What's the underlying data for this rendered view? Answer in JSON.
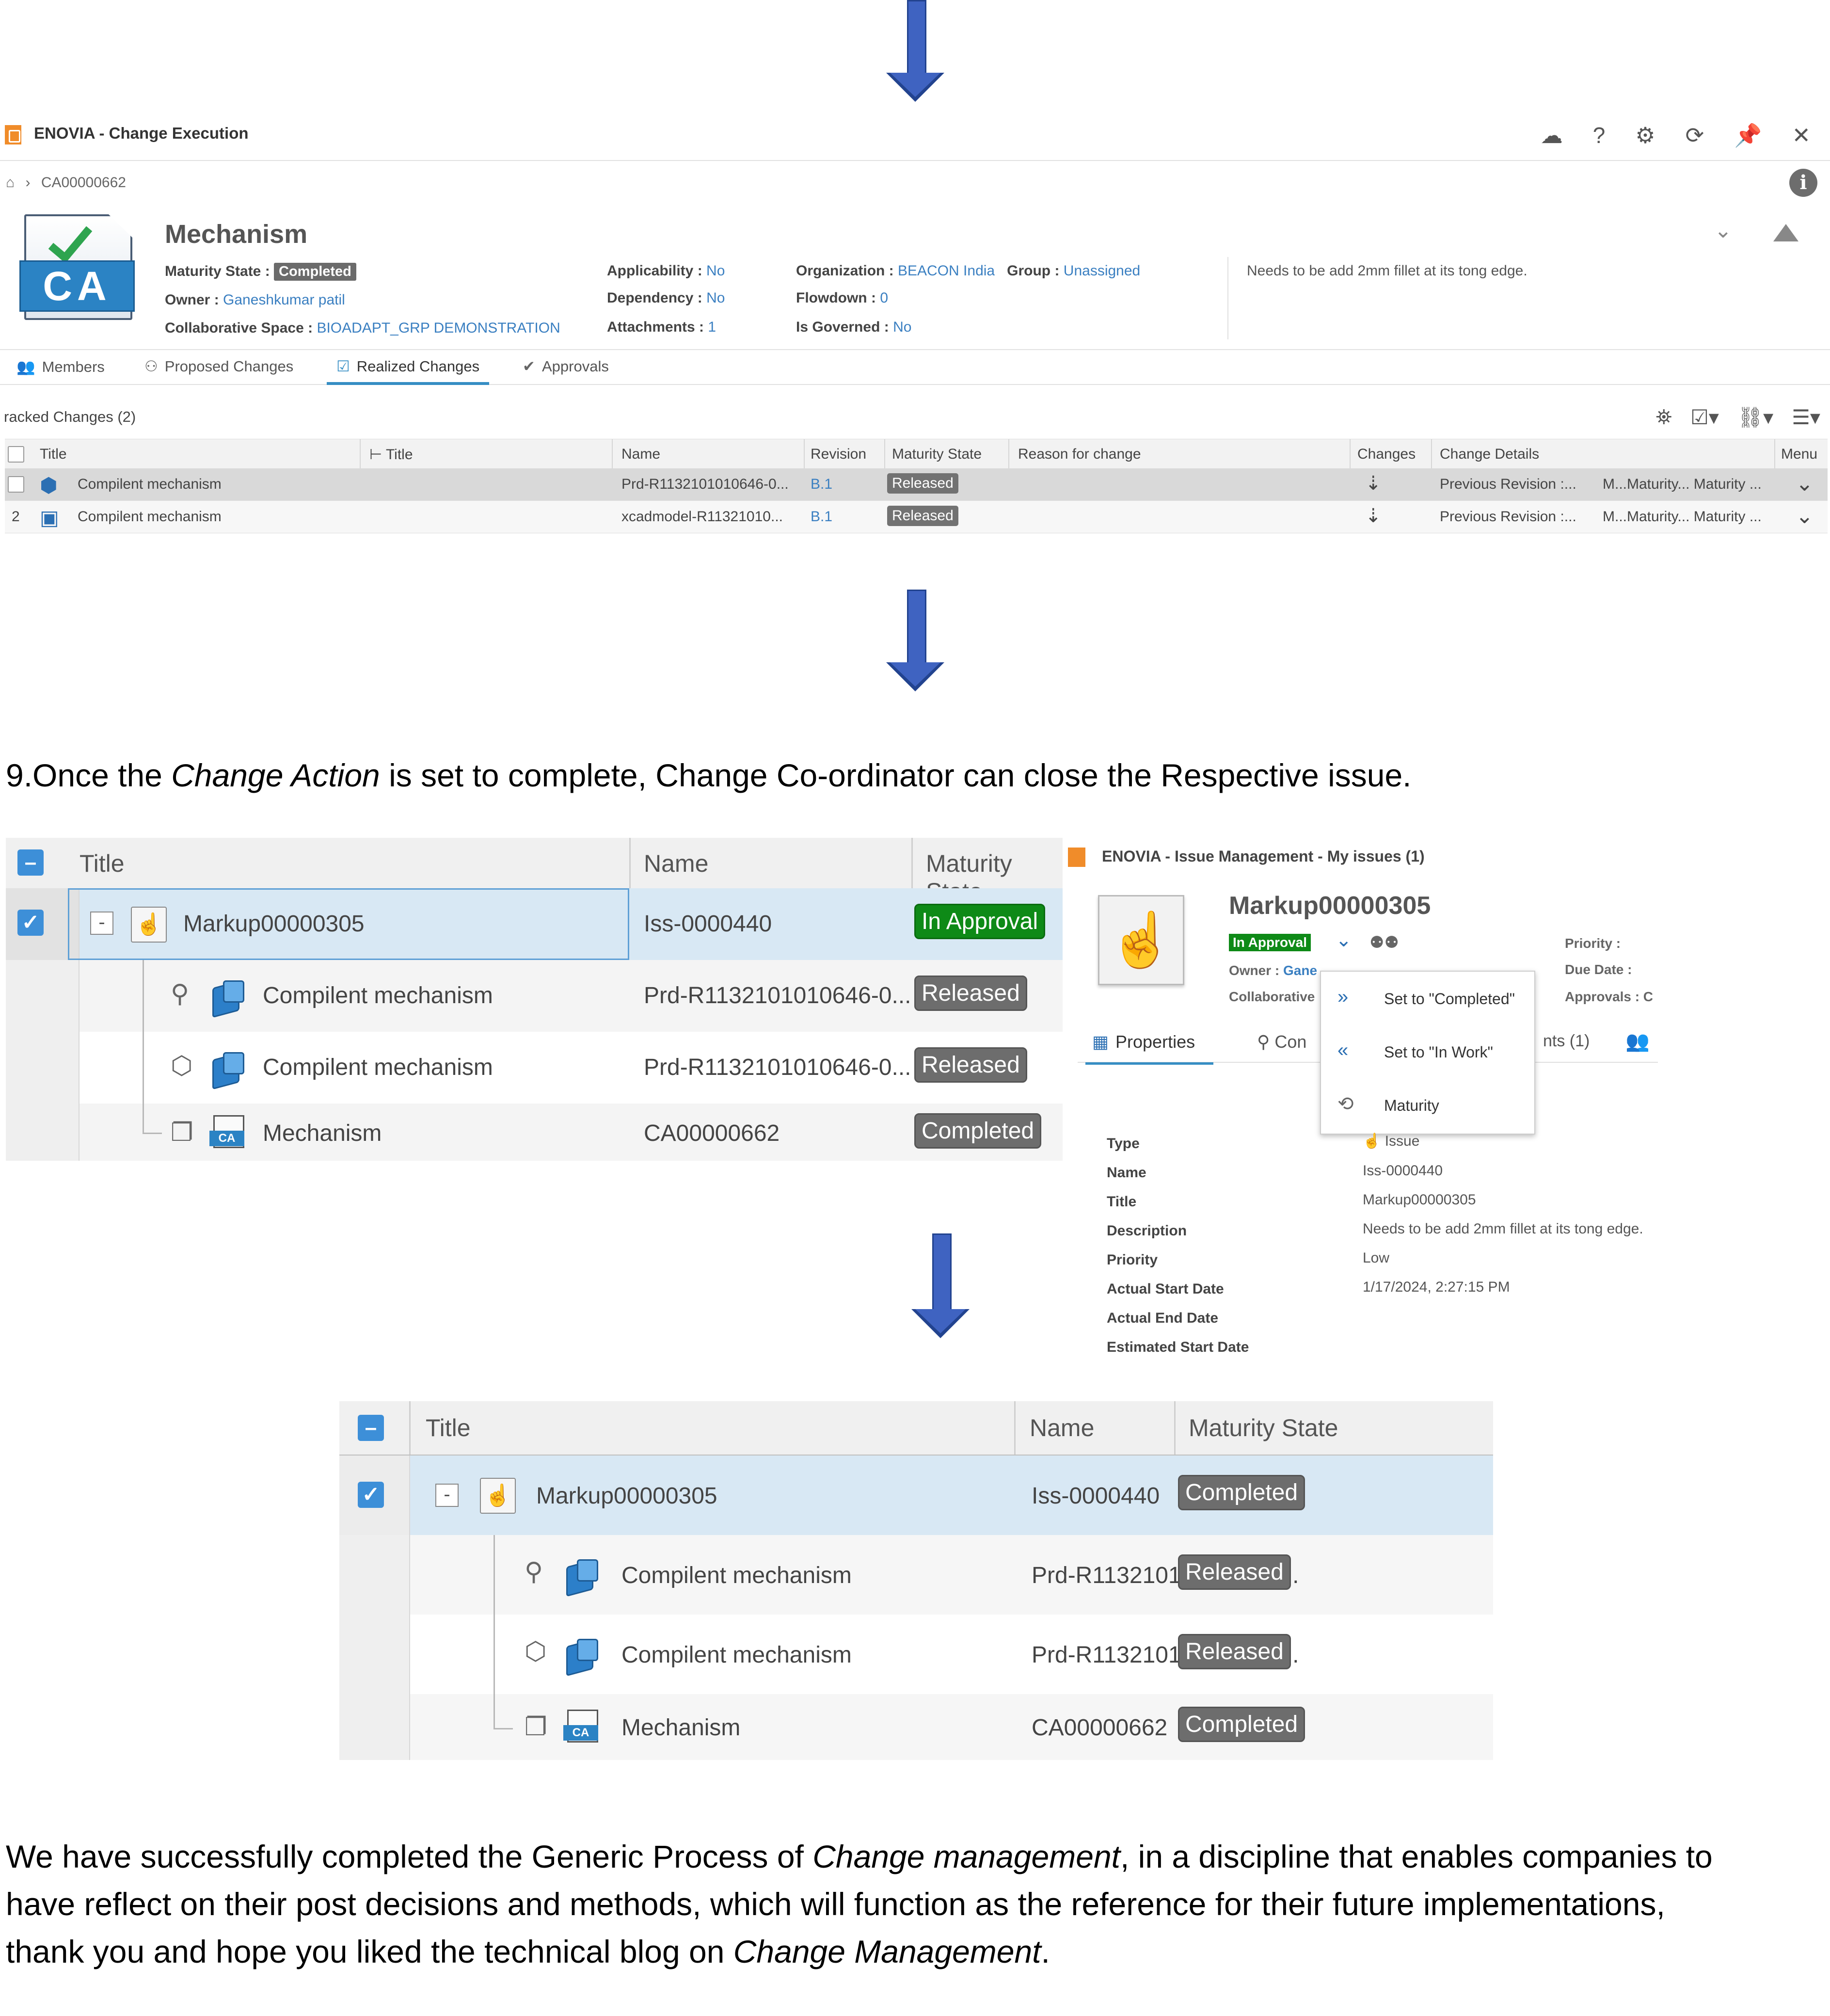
{
  "change_execution": {
    "app_title": "ENOVIA - Change Execution",
    "topbar_icons": [
      "cloud-icon",
      "help-icon",
      "gear-icon",
      "refresh-icon",
      "pin-icon",
      "close-icon"
    ],
    "topbar_glyphs": [
      "☁",
      "?",
      "⚙",
      "⟳",
      "📌",
      "✕"
    ],
    "breadcrumb": "CA00000662",
    "object_title": "Mechanism",
    "maturity_state_label": "Maturity State :",
    "maturity_state": "Completed",
    "owner_label": "Owner :",
    "owner": "Ganeshkumar patil",
    "collab_label": "Collaborative Space :",
    "collab": "BIOADAPT_GRP DEMONSTRATION",
    "applicability_label": "Applicability :",
    "applicability": "No",
    "dependency_label": "Dependency :",
    "dependency": "No",
    "attachments_label": "Attachments :",
    "attachments": "1",
    "organization_label": "Organization :",
    "organization": "BEACON India",
    "group_label": "Group :",
    "group": "Unassigned",
    "flowdown_label": "Flowdown :",
    "flowdown": "0",
    "governed_label": "Is Governed :",
    "governed": "No",
    "description": "Needs to be add 2mm fillet at its tong edge.",
    "tabs": [
      "Members",
      "Proposed Changes",
      "Realized Changes",
      "Approvals"
    ],
    "tracked_label": "racked Changes (2)",
    "columns": [
      "Title",
      "Title",
      "Name",
      "Revision",
      "Maturity State",
      "Reason for change",
      "Changes",
      "Change Details",
      "Menu"
    ],
    "rows": [
      {
        "num": "",
        "title": "Compilent mechanism",
        "name": "Prd-R1132101010646-0...",
        "revision": "B.1",
        "state": "Released",
        "details": "Previous Revision :...",
        "details2": "M...Maturity... Maturity ..."
      },
      {
        "num": "2",
        "title": "Compilent mechanism",
        "name": "xcadmodel-R11321010...",
        "revision": "B.1",
        "state": "Released",
        "details": "Previous Revision :...",
        "details2": "M...Maturity... Maturity ..."
      }
    ]
  },
  "step_text": {
    "prefix": "9.Once the ",
    "emph": "Change Action",
    "suffix": " is set to complete, Change Co-ordinator can close the Respective issue."
  },
  "tree_before": {
    "columns": [
      "Title",
      "Name",
      "Maturity State"
    ],
    "rows": [
      {
        "title": "Markup00000305",
        "name": "Iss-0000440",
        "state": "In Approval"
      },
      {
        "title": "Compilent mechanism",
        "name": "Prd-R1132101010646-0...",
        "state": "Released"
      },
      {
        "title": "Compilent mechanism",
        "name": "Prd-R1132101010646-0...",
        "state": "Released"
      },
      {
        "title": "Mechanism",
        "name": "CA00000662",
        "state": "Completed"
      }
    ]
  },
  "issue_panel": {
    "app_title": "ENOVIA - Issue Management - My issues (1)",
    "name": "Markup00000305",
    "state": "In Approval",
    "owner_label": "Owner :",
    "owner_partial": "Gane",
    "collab_partial": "Collaborative",
    "priority_label": "Priority :",
    "due_label": "Due Date :",
    "approvals_label": "Approvals : C",
    "menu": [
      "Set to \"Completed\"",
      "Set to \"In Work\"",
      "Maturity"
    ],
    "tab_properties": "Properties",
    "tab_partial": "Con",
    "tab_partial2": "nts (1)",
    "props": [
      {
        "label": "Type",
        "value": "Issue"
      },
      {
        "label": "Name",
        "value": "Iss-0000440"
      },
      {
        "label": "Title",
        "value": "Markup00000305"
      },
      {
        "label": "Description",
        "value": "Needs to be add 2mm fillet at its tong edge."
      },
      {
        "label": "Priority",
        "value": "Low"
      },
      {
        "label": "Actual Start Date",
        "value": "1/17/2024, 2:27:15 PM"
      },
      {
        "label": "Actual End Date",
        "value": ""
      },
      {
        "label": "Estimated Start Date",
        "value": ""
      }
    ]
  },
  "tree_after": {
    "columns": [
      "Title",
      "Name",
      "Maturity State"
    ],
    "rows": [
      {
        "title": "Markup00000305",
        "name": "Iss-0000440",
        "state": "Completed"
      },
      {
        "title": "Compilent mechanism",
        "name": "Prd-R1132101010646-0...",
        "state": "Released"
      },
      {
        "title": "Compilent mechanism",
        "name": "Prd-R1132101010646-0...",
        "state": "Released"
      },
      {
        "title": "Mechanism",
        "name": "CA00000662",
        "state": "Completed"
      }
    ]
  },
  "closing": {
    "p1": "We have successfully completed the Generic Process of ",
    "e1": "Change management",
    "p2": ", in a discipline that enables companies to",
    "line2": "have reflect on their post decisions and methods, which will function as the reference for their future implementations,",
    "p3": "thank you and hope you liked the technical blog on ",
    "e2": "Change Management",
    "p4": "."
  }
}
